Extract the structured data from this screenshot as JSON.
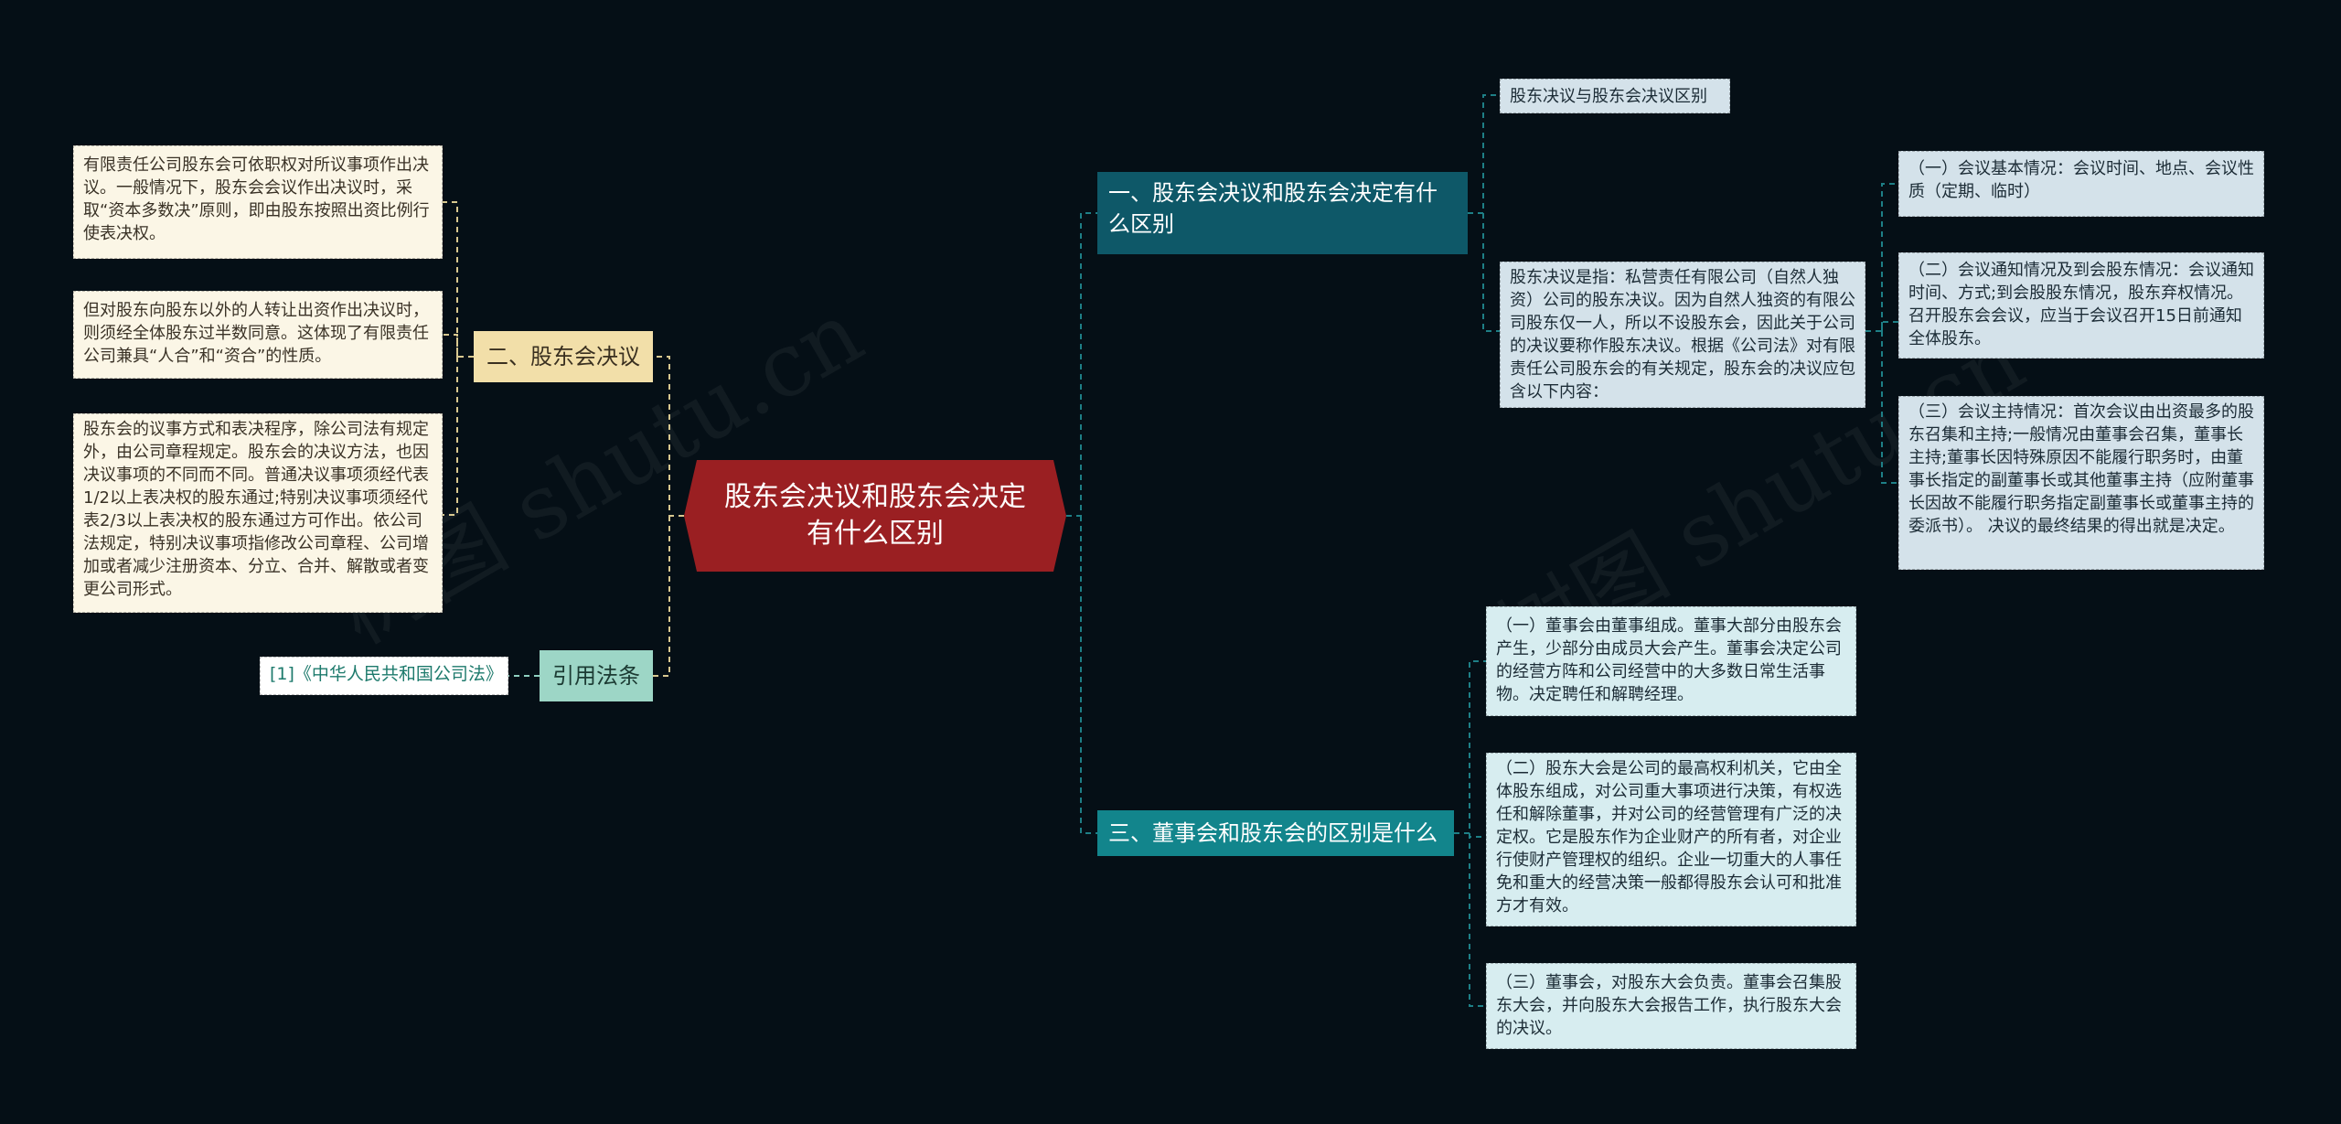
{
  "root": {
    "title": "股东会决议和股东会决定有什么区别"
  },
  "branches": {
    "b1": {
      "title": "一、股东会决议和股东会决定有什么区别"
    },
    "b2": {
      "title": "二、股东会决议"
    },
    "b3": {
      "title": "三、董事会和股东会的区别是什么"
    },
    "b4": {
      "title": "引用法条"
    }
  },
  "leaves": {
    "b1_diff": "股东决议与股东会决议区别",
    "b1_def": "股东决议是指：私营责任有限公司（自然人独资）公司的股东决议。因为自然人独资的有限公司股东仅一人，所以不设股东会，因此关于公司的决议要称作股东决议。根据《公司法》对有限责任公司股东会的有关规定，股东会的决议应包含以下内容：",
    "b1_s1": "（一）会议基本情况：会议时间、地点、会议性质（定期、临时）",
    "b1_s2": "（二）会议通知情况及到会股东情况：会议通知时间、方式;到会股股东情况，股东弃权情况。 召开股东会会议，应当于会议召开15日前通知全体股东。",
    "b1_s3": "（三）会议主持情况：首次会议由出资最多的股东召集和主持;一般情况由董事会召集，董事长主持;董事长因特殊原因不能履行职务时，由董事长指定的副董事长或其他董事主持（应附董事长因故不能履行职务指定副董事长或董事主持的委派书）。 决议的最终结果的得出就是决定。",
    "b2_l1": "有限责任公司股东会可依职权对所议事项作出决议。一般情况下，股东会会议作出决议时，采取“资本多数决”原则，即由股东按照出资比例行使表决权。",
    "b2_l2": "但对股东向股东以外的人转让出资作出决议时，则须经全体股东过半数同意。这体现了有限责任公司兼具“人合”和“资合”的性质。",
    "b2_l3": "股东会的议事方式和表决程序，除公司法有规定外，由公司章程规定。股东会的决议方法，也因决议事项的不同而不同。普通决议事项须经代表1/2以上表决权的股东通过;特别决议事项须经代表2/3以上表决权的股东通过方可作出。依公司法规定，特别决议事项指修改公司章程、公司增加或者减少注册资本、分立、合并、解散或者变更公司形式。",
    "b3_l1": "（一）董事会由董事组成。董事大部分由股东会产生，少部分由成员大会产生。董事会决定公司的经营方阵和公司经营中的大多数日常生活事物。决定聘任和解聘经理。",
    "b3_l2": "（二）股东大会是公司的最高权利机关，它由全体股东组成，对公司重大事项进行决策，有权选任和解除董事，并对公司的经营管理有广泛的决定权。它是股东作为企业财产的所有者，对企业行使财产管理权的组织。企业一切重大的人事任免和重大的经营决策一般都得股东会认可和批准方才有效。",
    "b3_l3": "（三）董事会，对股东大会负责。董事会召集股东大会，并向股东大会报告工作，执行股东大会的决议。",
    "b4_l1": "[1]《中华人民共和国公司法》"
  },
  "colors": {
    "background": "#050f16",
    "root": "#9a1f22",
    "branch_blue": "#0e5868",
    "branch_teal": "#12858c",
    "branch_cream": "#f2dfa9",
    "branch_mint": "#9dd6c6",
    "connector_right": "#1e7f86",
    "connector_left": "#d8c890"
  }
}
